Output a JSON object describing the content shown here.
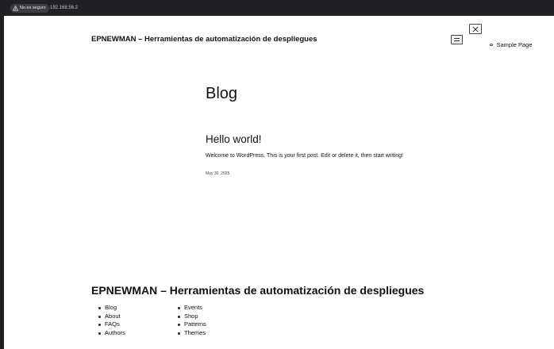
{
  "browser": {
    "security_label": "No es seguro",
    "url": "192.168.56.2"
  },
  "header": {
    "site_title": "EPNEWMAN – Herramientas de automatización de despliegues",
    "nav": [
      {
        "label": "Sample Page"
      }
    ]
  },
  "main": {
    "heading": "Blog",
    "post": {
      "title": "Hello world!",
      "excerpt": "Welcome to WordPress. This is your first post. Edit or delete it, then start writing!",
      "date": "May 30, 2025"
    }
  },
  "footer": {
    "site_title": "EPNEWMAN – Herramientas de automatización de despliegues",
    "column_a": [
      {
        "label": "Blog"
      },
      {
        "label": "About"
      },
      {
        "label": "FAQs"
      },
      {
        "label": "Authors"
      }
    ],
    "column_b": [
      {
        "label": "Events"
      },
      {
        "label": "Shop"
      },
      {
        "label": "Patterns"
      },
      {
        "label": "Themes"
      }
    ]
  }
}
